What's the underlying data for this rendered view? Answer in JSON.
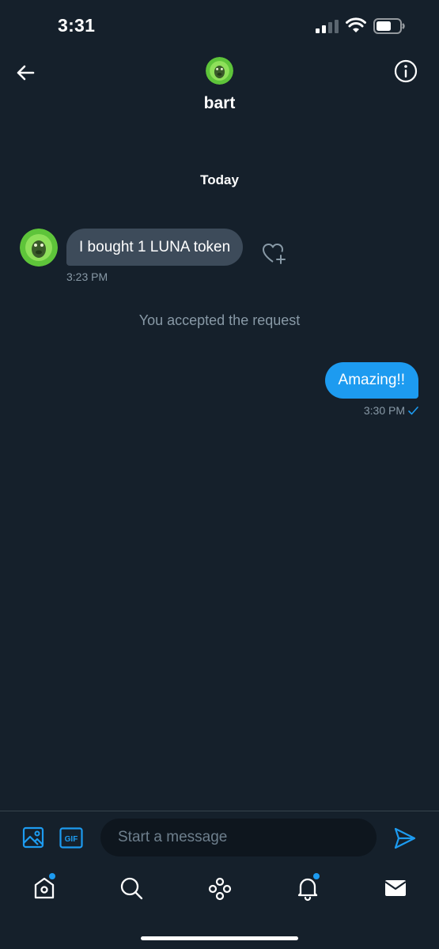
{
  "status_bar": {
    "time": "3:31"
  },
  "header": {
    "name": "bart"
  },
  "conversation": {
    "date_separator": "Today",
    "incoming": {
      "text": "I bought 1 LUNA token",
      "time": "3:23 PM"
    },
    "system_note": "You accepted the request",
    "outgoing": {
      "text": "Amazing!!",
      "time": "3:30 PM"
    }
  },
  "composer": {
    "placeholder": "Start a message",
    "gif_label": "GIF"
  },
  "colors": {
    "background": "#15202b",
    "accent": "#1d9bf0",
    "incoming_bubble": "#3d4b5a",
    "muted_text": "#8899a6"
  },
  "icons": {
    "header": [
      "back-arrow-icon",
      "info-icon"
    ],
    "message": [
      "heart-plus-icon",
      "read-check-icon"
    ],
    "composer": [
      "image-icon",
      "gif-icon",
      "send-icon"
    ],
    "tabs": [
      "home-icon",
      "search-icon",
      "spaces-icon",
      "bell-icon",
      "mail-icon"
    ]
  },
  "tabs": [
    {
      "name": "home",
      "badge": true
    },
    {
      "name": "search",
      "badge": false
    },
    {
      "name": "spaces",
      "badge": false
    },
    {
      "name": "notifications",
      "badge": true
    },
    {
      "name": "messages",
      "badge": false,
      "active": true
    }
  ]
}
